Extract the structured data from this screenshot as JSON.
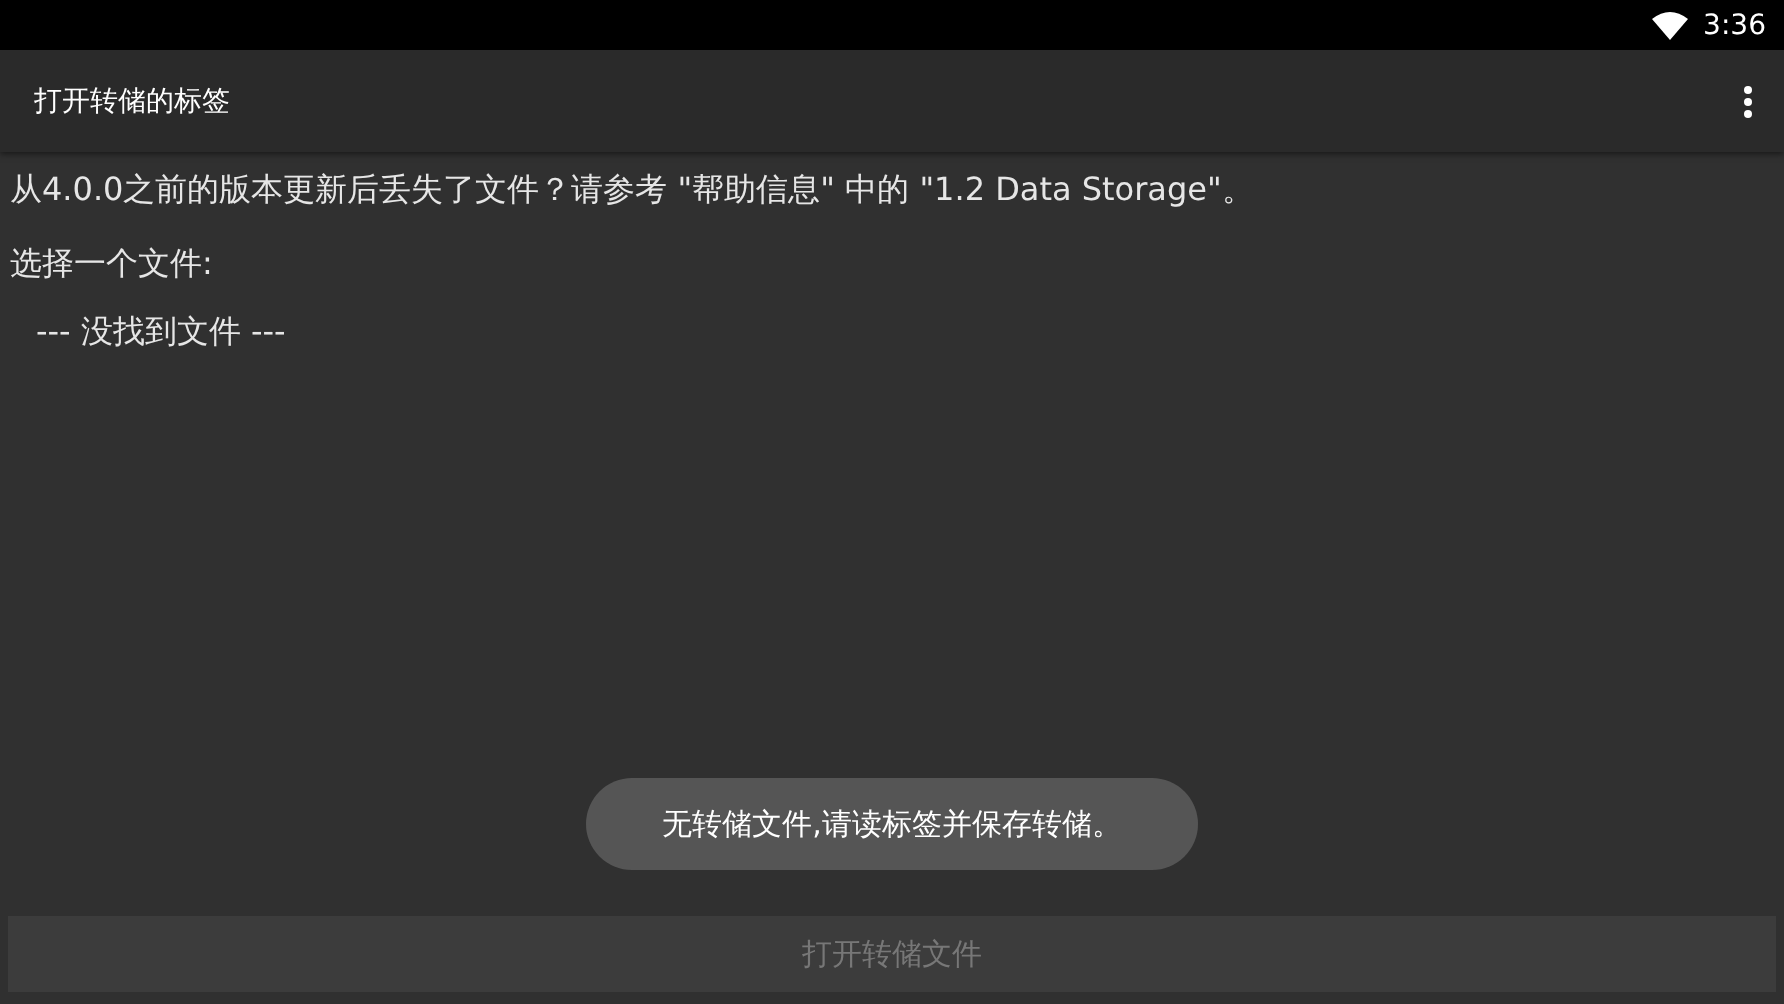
{
  "status_bar": {
    "time": "3:36"
  },
  "app_bar": {
    "title": "打开转储的标签"
  },
  "content": {
    "notice": "从4.0.0之前的版本更新后丢失了文件？请参考 \"帮助信息\" 中的 \"1.2 Data Storage\"。",
    "prompt": "选择一个文件:",
    "empty_item": "--- 没找到文件 ---"
  },
  "toast": "无转储文件,请读标签并保存转储。",
  "button": {
    "label": "打开转储文件",
    "disabled": true
  }
}
